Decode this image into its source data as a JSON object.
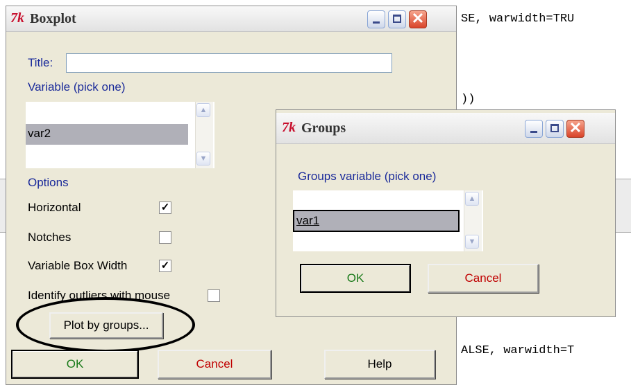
{
  "background_code": {
    "line1": "SE, warwidth=TRU",
    "line2": "))",
    "line3": "ALSE, warwidth=T"
  },
  "boxplot_dialog": {
    "title": "Boxplot",
    "logo": "7k",
    "title_label": "Title:",
    "title_value": "",
    "variable_label": "Variable (pick one)",
    "variable_items": [
      "var2"
    ],
    "options_label": "Options",
    "options": [
      {
        "label": "Horizontal",
        "checked": true
      },
      {
        "label": "Notches",
        "checked": false
      },
      {
        "label": "Variable Box Width",
        "checked": true
      },
      {
        "label": "Identify outliers with mouse",
        "checked": false
      }
    ],
    "plot_by_groups_label": "Plot by groups...",
    "ok_label": "OK",
    "cancel_label": "Cancel",
    "help_label": "Help"
  },
  "groups_dialog": {
    "title": "Groups",
    "logo": "7k",
    "groups_label": "Groups variable (pick one)",
    "items": [
      "var1"
    ],
    "ok_label": "OK",
    "cancel_label": "Cancel"
  },
  "colors": {
    "label_blue": "#1a2a9a",
    "ok_green": "#1a7a1a",
    "cancel_red": "#c00000",
    "logo_red": "#c8102e"
  },
  "icons": [
    "tk-logo",
    "minimize-icon",
    "maximize-icon",
    "close-icon",
    "scroll-up-icon",
    "scroll-down-icon",
    "check-icon"
  ]
}
